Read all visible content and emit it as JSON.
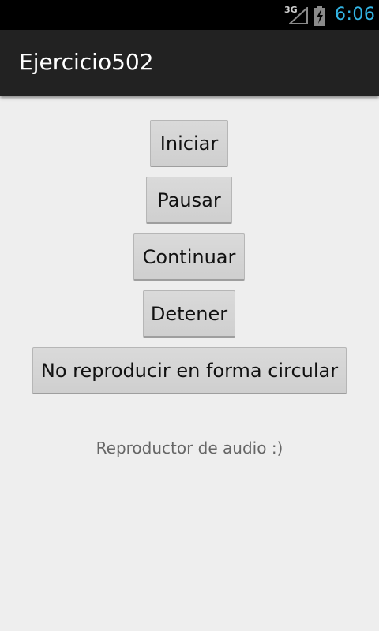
{
  "status_bar": {
    "network_label": "3G",
    "time": "6:06",
    "signal_icon": "signal-icon",
    "battery_icon": "battery-charging-icon"
  },
  "action_bar": {
    "title": "Ejercicio502"
  },
  "buttons": {
    "start": "Iniciar",
    "pause": "Pausar",
    "resume": "Continuar",
    "stop": "Detener",
    "loop_toggle": "No reproducir en forma circular"
  },
  "status_text": "Reproductor de audio :)",
  "colors": {
    "accent": "#33b5e5",
    "action_bar": "#222222",
    "background": "#eeeeee"
  }
}
